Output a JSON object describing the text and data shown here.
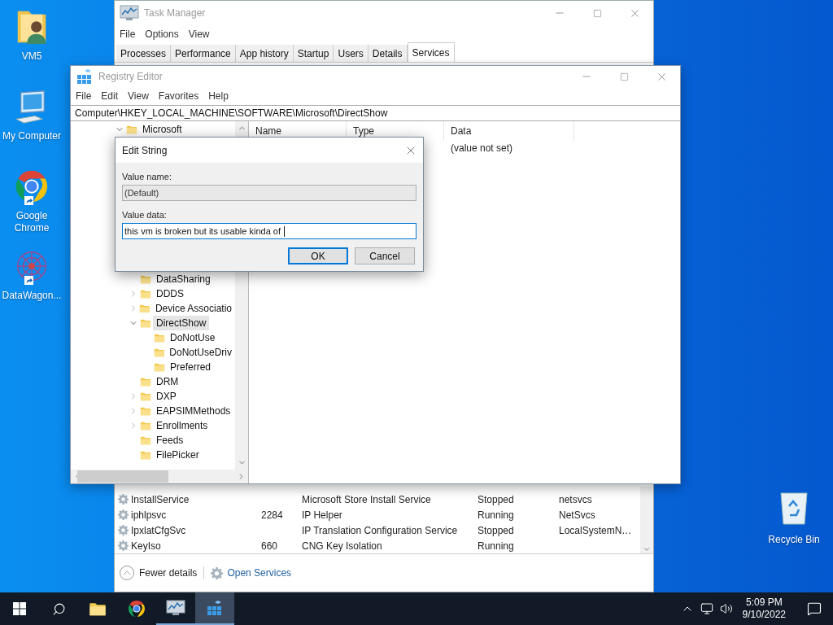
{
  "desktop_icons": [
    {
      "label": "VM5",
      "kind": "user-folder",
      "shortcut": false
    },
    {
      "label": "My Computer",
      "kind": "computer",
      "shortcut": false
    },
    {
      "label": "Google Chrome",
      "kind": "chrome",
      "shortcut": true
    },
    {
      "label": "DataWagon...",
      "kind": "network-star",
      "shortcut": true
    }
  ],
  "recycle_bin": {
    "label": "Recycle Bin"
  },
  "task_manager": {
    "title": "Task Manager",
    "menu": [
      "File",
      "Options",
      "View"
    ],
    "tabs": [
      {
        "label": "Processes",
        "selected": false
      },
      {
        "label": "Performance",
        "selected": false
      },
      {
        "label": "App history",
        "selected": false
      },
      {
        "label": "Startup",
        "selected": false
      },
      {
        "label": "Users",
        "selected": false
      },
      {
        "label": "Details",
        "selected": false
      },
      {
        "label": "Services",
        "selected": true
      }
    ],
    "services": [
      {
        "name": "InstallService",
        "description": "Microsoft Store Install Service",
        "status": "Stopped",
        "group": "netsvcs"
      },
      {
        "name": "iphlpsvc",
        "pid": "2284",
        "description": "IP Helper",
        "status": "Running",
        "group": "NetSvcs"
      },
      {
        "name": "IpxlatCfgSvc",
        "description": "IP Translation Configuration Service",
        "status": "Stopped",
        "group": "LocalSystemN…"
      },
      {
        "name": "KeyIso",
        "pid": "660",
        "description": "CNG Key Isolation",
        "status": "Running"
      }
    ],
    "fewer_details": "Fewer details",
    "open_services": "Open Services"
  },
  "registry_editor": {
    "title": "Registry Editor",
    "menu": [
      "File",
      "Edit",
      "View",
      "Favorites",
      "Help"
    ],
    "address": "Computer\\HKEY_LOCAL_MACHINE\\SOFTWARE\\Microsoft\\DirectShow",
    "tree": [
      {
        "label": "Microsoft",
        "expandable": true,
        "expanded": true,
        "selected": false,
        "children": [
          {
            "label": "DataSharing",
            "expandable": false,
            "selected": false
          },
          {
            "label": "DDDS",
            "expandable": true,
            "expanded": false,
            "selected": false
          },
          {
            "label": "Device Associatio",
            "expandable": true,
            "expanded": false,
            "selected": false
          },
          {
            "label": "DirectShow",
            "expandable": true,
            "expanded": true,
            "selected": true,
            "children": [
              {
                "label": "DoNotUse",
                "expandable": false,
                "selected": false
              },
              {
                "label": "DoNotUseDriv",
                "expandable": false,
                "selected": false
              },
              {
                "label": "Preferred",
                "expandable": false,
                "selected": false
              }
            ]
          },
          {
            "label": "DRM",
            "expandable": false,
            "selected": false
          },
          {
            "label": "DXP",
            "expandable": true,
            "expanded": false,
            "selected": false
          },
          {
            "label": "EAPSIMMethods",
            "expandable": true,
            "expanded": false,
            "selected": false
          },
          {
            "label": "Enrollments",
            "expandable": true,
            "expanded": false,
            "selected": false
          },
          {
            "label": "Feeds",
            "expandable": false,
            "selected": false
          },
          {
            "label": "FilePicker",
            "expandable": false,
            "selected": false
          }
        ]
      }
    ],
    "columns": [
      "Name",
      "Type",
      "Data"
    ],
    "rows": [
      {
        "data": "(value not set)"
      }
    ]
  },
  "dialog": {
    "title": "Edit String",
    "value_name_label": "Value name:",
    "value_name": "(Default)",
    "value_data_label": "Value data:",
    "value_data": "this vm is broken but its usable kinda of",
    "ok": "OK",
    "cancel": "Cancel"
  },
  "taskbar": {
    "apps": [
      {
        "kind": "explorer",
        "running": false,
        "active": false
      },
      {
        "kind": "chrome",
        "running": false,
        "active": false
      },
      {
        "kind": "task-manager",
        "running": true,
        "active": false
      },
      {
        "kind": "registry",
        "running": true,
        "active": true
      }
    ],
    "time": "5:09 PM",
    "date": "9/10/2022"
  }
}
